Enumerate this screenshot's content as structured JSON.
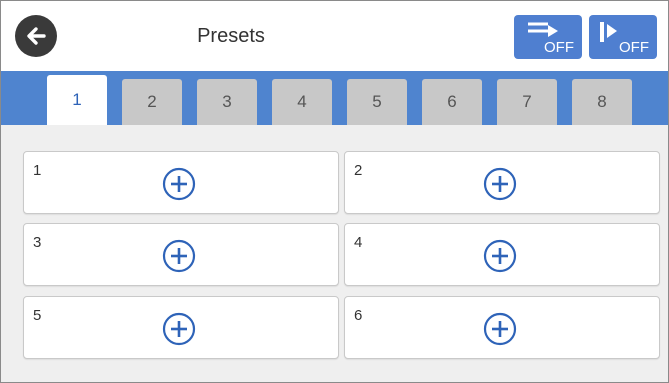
{
  "header": {
    "title": "Presets",
    "btn1_label": "OFF",
    "btn2_label": "OFF",
    "icons": {
      "back": "back-arrow-icon",
      "btn1": "continuous-scan-icon",
      "btn2": "start-off-icon"
    }
  },
  "tabs": [
    "1",
    "2",
    "3",
    "4",
    "5",
    "6",
    "7",
    "8"
  ],
  "active_tab": "1",
  "presets": [
    {
      "number": "1",
      "icon": "add-icon"
    },
    {
      "number": "2",
      "icon": "add-icon"
    },
    {
      "number": "3",
      "icon": "add-icon"
    },
    {
      "number": "4",
      "icon": "add-icon"
    },
    {
      "number": "5",
      "icon": "add-icon"
    },
    {
      "number": "6",
      "icon": "add-icon"
    }
  ],
  "colors": {
    "accent": "#4f84cf",
    "button": "#4f7fd0",
    "icon_blue": "#2e63b8"
  }
}
